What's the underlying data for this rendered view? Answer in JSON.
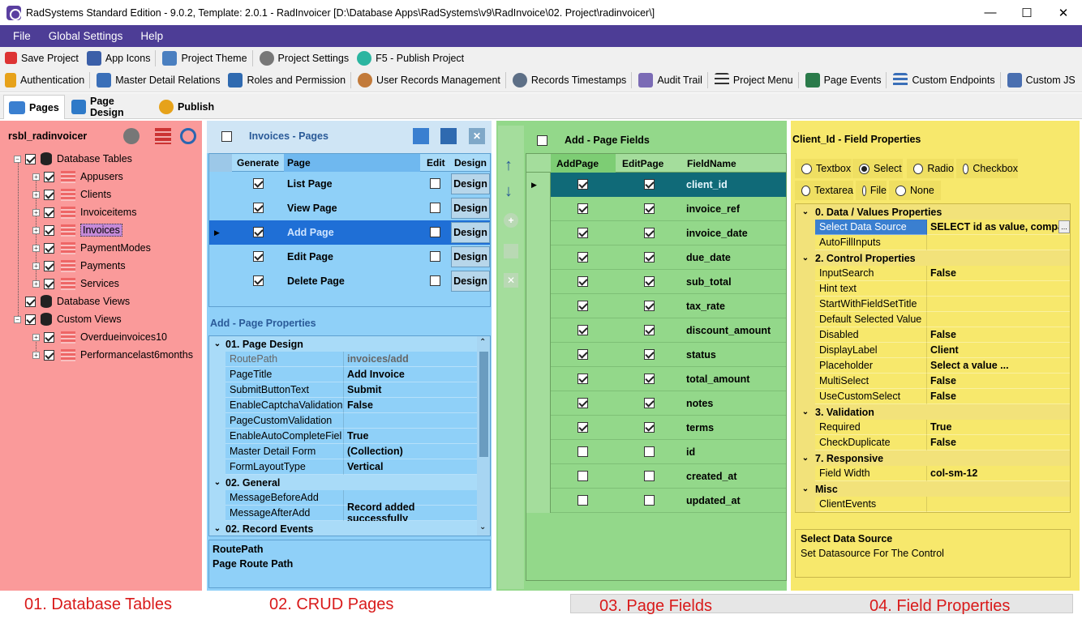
{
  "window": {
    "title": "RadSystems Standard Edition - 9.0.2, Template: 2.0.1 - RadInvoicer [D:\\Database Apps\\RadSystems\\v9\\RadInvoice\\02. Project\\radinvoicer\\]"
  },
  "menu": [
    "File",
    "Global Settings",
    "Help"
  ],
  "toolbar1": [
    "Save Project",
    "App Icons",
    "Project Theme",
    "Project Settings",
    "F5 - Publish Project"
  ],
  "toolbar2": [
    "Authentication",
    "Master Detail Relations",
    "Roles and Permission",
    "User Records Management",
    "Records Timestamps",
    "Audit Trail",
    "Project Menu",
    "Page Events",
    "Custom Endpoints",
    "Custom JS"
  ],
  "tabs": [
    "Pages",
    "Page Design",
    "Publish"
  ],
  "db": {
    "name": "rsbl_radinvoicer",
    "tables_label": "Database Tables",
    "tables": [
      "Appusers",
      "Clients",
      "Invoiceitems",
      "Invoices",
      "PaymentModes",
      "Payments",
      "Services"
    ],
    "views_label": "Database Views",
    "custom_views_label": "Custom Views",
    "custom_views": [
      "Overdueinvoices10",
      "Performancelast6months"
    ]
  },
  "pages": {
    "title": "Invoices - Pages",
    "headers": {
      "generate": "Generate",
      "page": "Page",
      "edit": "Edit",
      "design": "Design"
    },
    "rows": [
      {
        "name": "List Page",
        "design": "Design"
      },
      {
        "name": "View Page",
        "design": "Design"
      },
      {
        "name": "Add Page",
        "design": "Design"
      },
      {
        "name": "Edit Page",
        "design": "Design"
      },
      {
        "name": "Delete Page",
        "design": "Design"
      }
    ],
    "props_title": "Add - Page Properties",
    "props": [
      {
        "cat": "01. Page Design"
      },
      {
        "name": "RoutePath",
        "value": "invoices/add",
        "dim": true
      },
      {
        "name": "PageTitle",
        "value": "Add Invoice"
      },
      {
        "name": "SubmitButtonText",
        "value": "Submit"
      },
      {
        "name": "EnableCaptchaValidation",
        "value": "False"
      },
      {
        "name": "PageCustomValidation",
        "value": ""
      },
      {
        "name": "EnableAutoCompleteFiel",
        "value": "True"
      },
      {
        "name": "Master Detail Form",
        "value": "(Collection)"
      },
      {
        "name": "FormLayoutType",
        "value": "Vertical"
      },
      {
        "cat": "02. General"
      },
      {
        "name": "MessageBeforeAdd",
        "value": ""
      },
      {
        "name": "MessageAfterAdd",
        "value": "Record added successfully"
      },
      {
        "cat": "02. Record Events"
      }
    ],
    "desc_title": "RoutePath",
    "desc_text": "Page Route Path"
  },
  "fields": {
    "title": "Add - Page Fields",
    "headers": {
      "add": "AddPage",
      "edit": "EditPage",
      "name": "FieldName"
    },
    "rows": [
      {
        "name": "client_id",
        "add": true,
        "edit": true
      },
      {
        "name": "invoice_ref",
        "add": true,
        "edit": true
      },
      {
        "name": "invoice_date",
        "add": true,
        "edit": true
      },
      {
        "name": "due_date",
        "add": true,
        "edit": true
      },
      {
        "name": "sub_total",
        "add": true,
        "edit": true
      },
      {
        "name": "tax_rate",
        "add": true,
        "edit": true
      },
      {
        "name": "discount_amount",
        "add": true,
        "edit": true
      },
      {
        "name": "status",
        "add": true,
        "edit": true
      },
      {
        "name": "total_amount",
        "add": true,
        "edit": true
      },
      {
        "name": "notes",
        "add": true,
        "edit": true
      },
      {
        "name": "terms",
        "add": true,
        "edit": true
      },
      {
        "name": "id",
        "add": false,
        "edit": false
      },
      {
        "name": "created_at",
        "add": false,
        "edit": false
      },
      {
        "name": "updated_at",
        "add": false,
        "edit": false
      }
    ]
  },
  "fieldprops": {
    "title": "Client_Id - Field Properties",
    "controls": [
      "Textbox",
      "Select",
      "Radio",
      "Checkbox",
      "Textarea",
      "File",
      "None"
    ],
    "selected_control": "Select",
    "props": [
      {
        "cat": "0. Data / Values Properties"
      },
      {
        "name": "Select Data Source",
        "value": "SELECT id as value, company_",
        "sel": true
      },
      {
        "name": "AutoFillInputs",
        "value": ""
      },
      {
        "cat": "2. Control Properties"
      },
      {
        "name": "InputSearch",
        "value": "False"
      },
      {
        "name": "Hint text",
        "value": ""
      },
      {
        "name": "StartWithFieldSetTitle",
        "value": ""
      },
      {
        "name": "Default Selected Value",
        "value": ""
      },
      {
        "name": "Disabled",
        "value": "False"
      },
      {
        "name": "DisplayLabel",
        "value": "Client"
      },
      {
        "name": "Placeholder",
        "value": "Select a value ..."
      },
      {
        "name": "MultiSelect",
        "value": "False"
      },
      {
        "name": "UseCustomSelect",
        "value": "False"
      },
      {
        "cat": "3. Validation"
      },
      {
        "name": "Required",
        "value": "True"
      },
      {
        "name": "CheckDuplicate",
        "value": "False"
      },
      {
        "cat": "7. Responsive"
      },
      {
        "name": "Field Width",
        "value": "col-sm-12"
      },
      {
        "cat": "Misc"
      },
      {
        "name": "ClientEvents",
        "value": ""
      }
    ],
    "desc_title": "Select Data Source",
    "desc_text": "Set Datasource For The Control"
  },
  "labels": {
    "p1": "01. Database Tables",
    "p2": "02. CRUD Pages",
    "p3": "03. Page Fields",
    "p4": "04. Field Properties"
  }
}
